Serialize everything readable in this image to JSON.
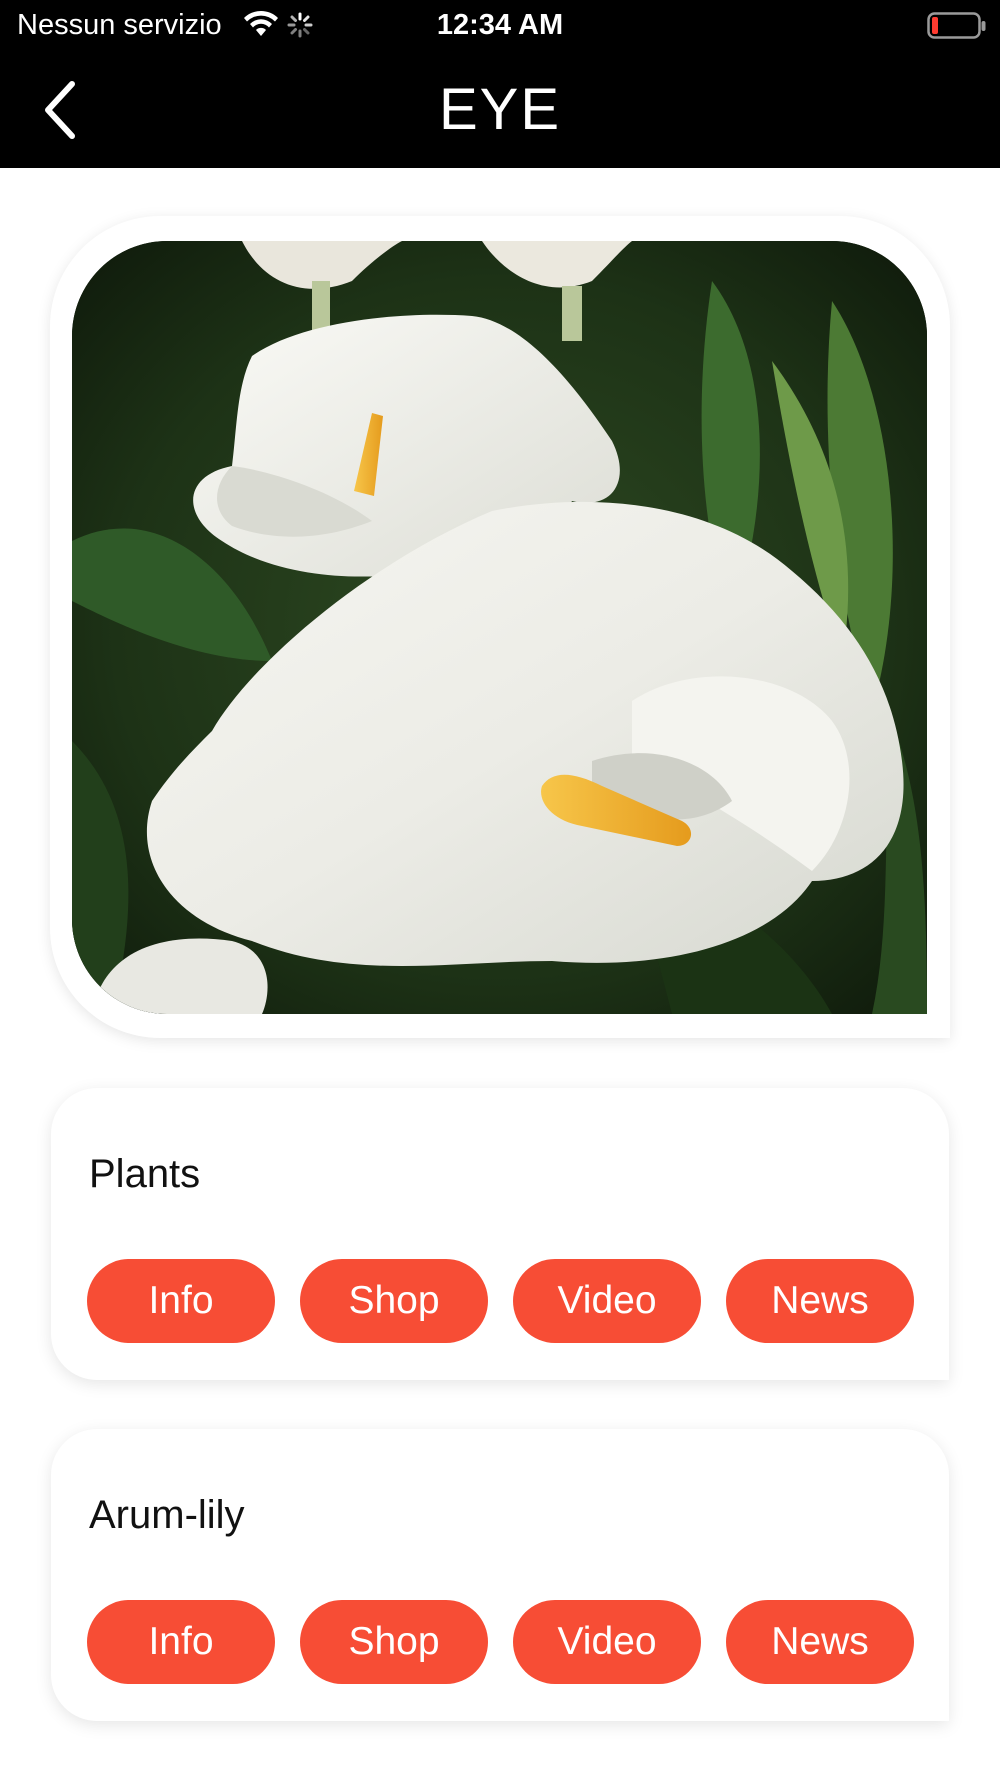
{
  "status_bar": {
    "carrier": "Nessun servizio",
    "time": "12:34 AM",
    "icons": [
      "wifi-icon",
      "loading-spinner-icon",
      "battery-low-icon"
    ],
    "battery_color": "#ff3b30"
  },
  "nav": {
    "title": "EYE",
    "back_icon": "chevron-left-icon"
  },
  "photo": {
    "subject": "white calla lily flowers"
  },
  "categories": [
    {
      "title": "Plants",
      "buttons": [
        "Info",
        "Shop",
        "Video",
        "News"
      ]
    },
    {
      "title": "Arum-lily",
      "buttons": [
        "Info",
        "Shop",
        "Video",
        "News"
      ]
    }
  ],
  "colors": {
    "accent": "#f74d35",
    "header_bg": "#000000",
    "page_bg": "#ffffff"
  }
}
